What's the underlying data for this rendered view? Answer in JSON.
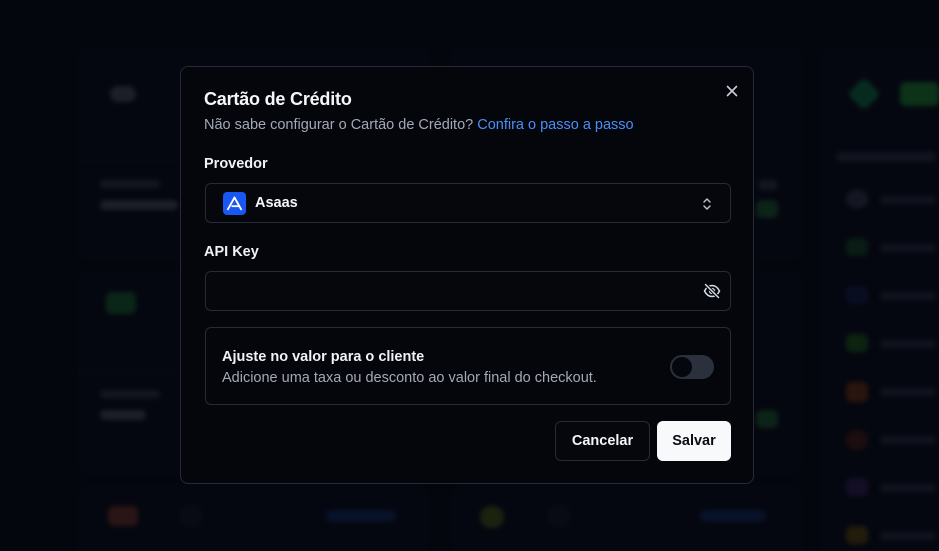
{
  "modal": {
    "title": "Cartão de Crédito",
    "subtitle": "Não sabe configurar o Cartão de Crédito?",
    "subtitle_link": "Confira o passo a passo",
    "provider_label": "Provedor",
    "provider_value": "Asaas",
    "provider_icon": "asaas-logo",
    "api_key_label": "API Key",
    "api_key_value": "",
    "api_key_icon": "eye-off-icon",
    "adjust_title": "Ajuste no valor para o cliente",
    "adjust_description": "Adicione uma taxa ou desconto ao valor final do checkout.",
    "adjust_enabled": false,
    "cancel_label": "Cancelar",
    "save_label": "Salvar",
    "close_icon": "close-icon"
  },
  "colors": {
    "accent_link": "#4b8ef5",
    "provider_brand": "#1956f2",
    "background": "#060913",
    "modal_background": "#04060c"
  }
}
